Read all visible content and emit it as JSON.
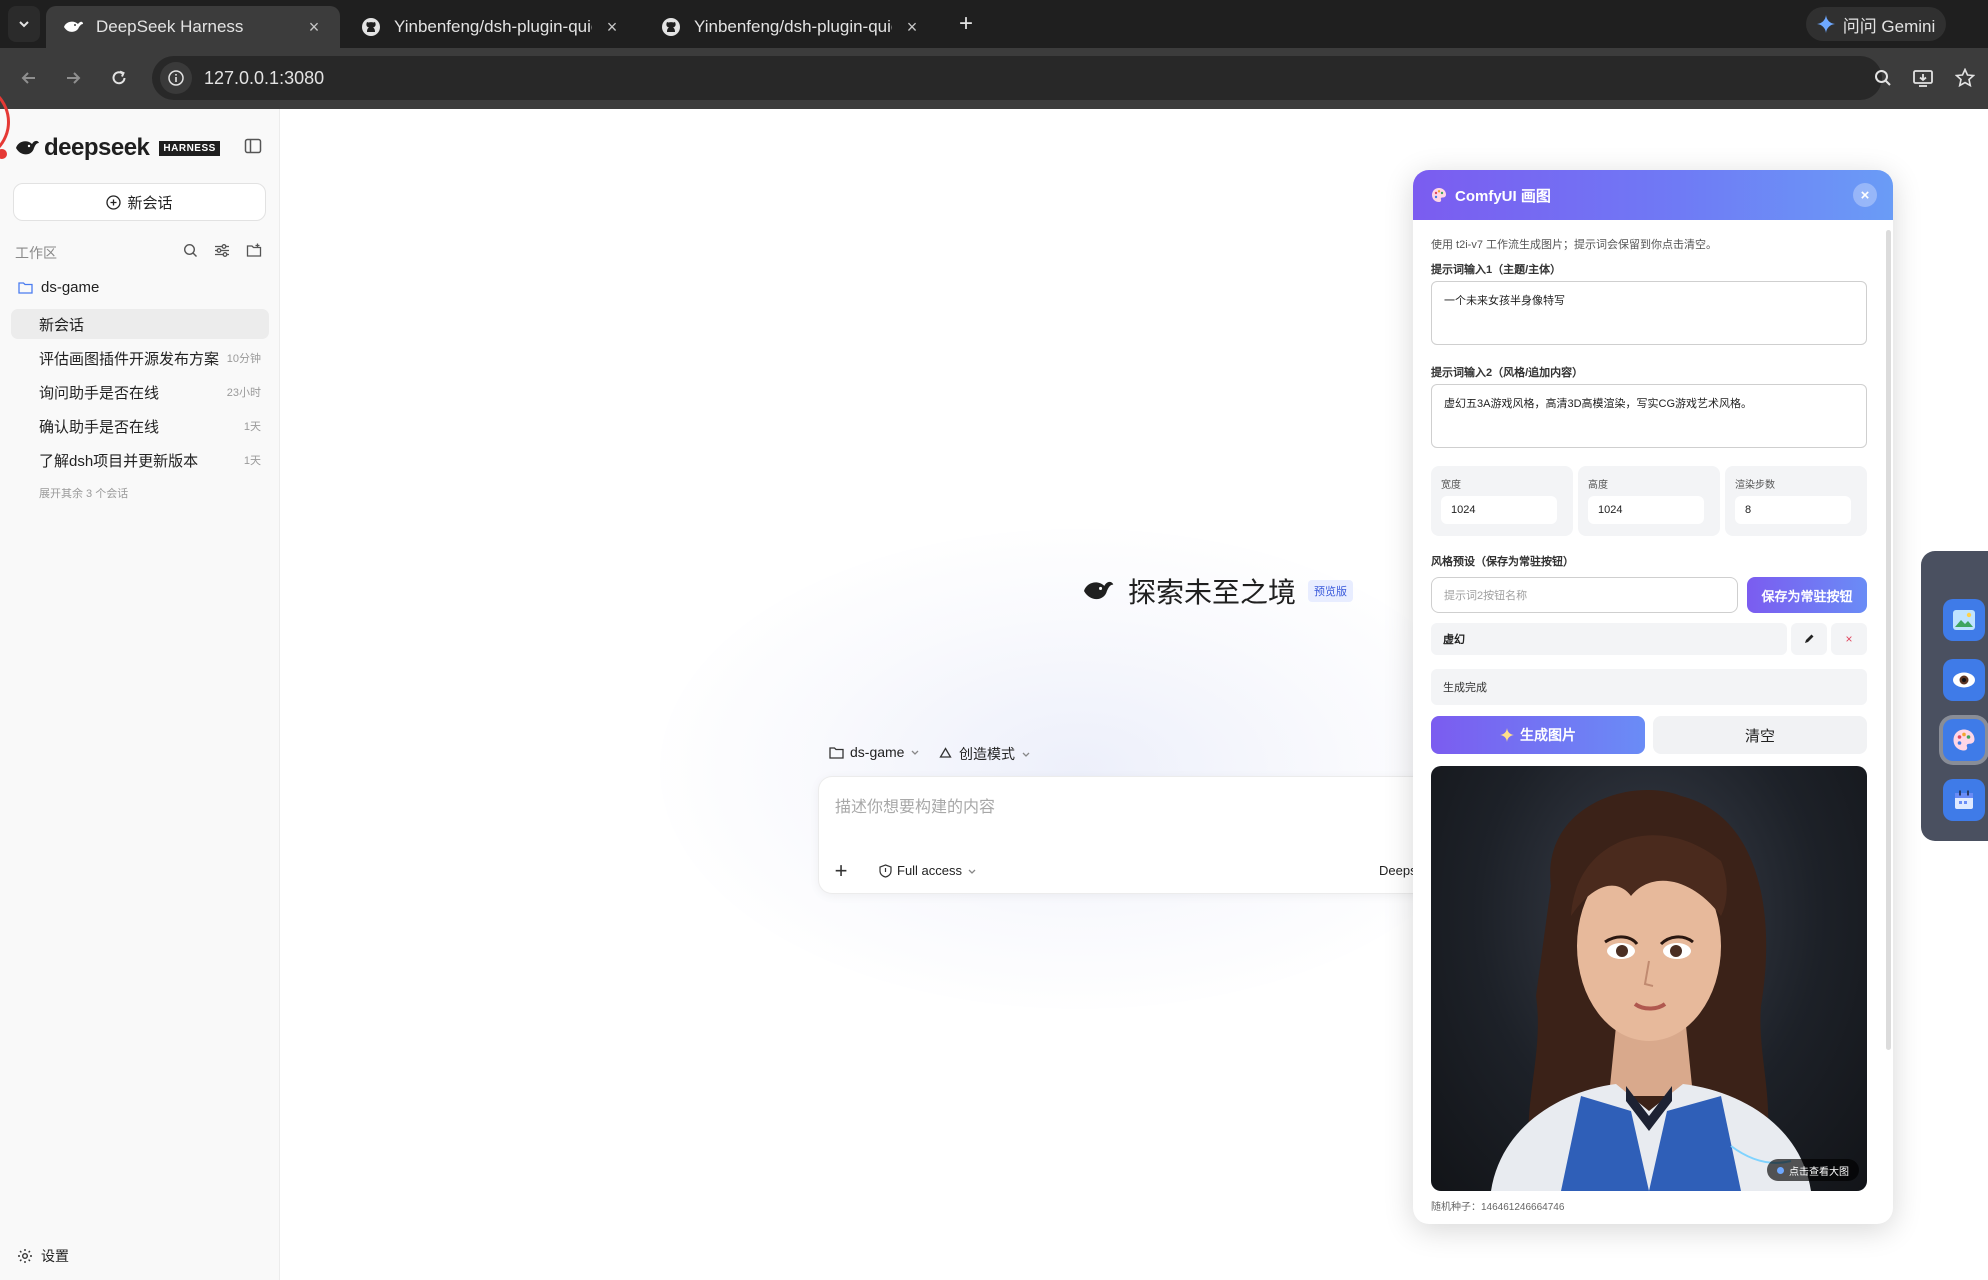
{
  "browser": {
    "tabs": [
      {
        "title": "DeepSeek Harness",
        "active": true
      },
      {
        "title": "Yinbenfeng/dsh-plugin-quick",
        "active": false
      },
      {
        "title": "Yinbenfeng/dsh-plugin-quick",
        "active": false
      }
    ],
    "gemini_label": "问问 Gemini",
    "url": "127.0.0.1:3080"
  },
  "sidebar": {
    "logo_text": "deepseek",
    "logo_badge": "HARNESS",
    "new_chat_label": "新会话",
    "workspace_label": "工作区",
    "folder_name": "ds-game",
    "conversations": [
      {
        "title": "新会话",
        "time": ""
      },
      {
        "title": "评估画图插件开源发布方案",
        "time": "10分钟"
      },
      {
        "title": "询问助手是否在线",
        "time": "23小时"
      },
      {
        "title": "确认助手是否在线",
        "time": "1天"
      },
      {
        "title": "了解dsh项目并更新版本",
        "time": "1天"
      }
    ],
    "expand_more": "展开其余 3 个会话",
    "settings_label": "设置"
  },
  "main": {
    "hero_title": "探索未至之境",
    "hero_badge": "预览版",
    "context_folder": "ds-game",
    "mode_label": "创造模式",
    "composer_placeholder": "描述你想要构建的内容",
    "access_label": "Full access",
    "model_label": "Deeps"
  },
  "comfy_panel": {
    "title": "ComfyUI 画图",
    "description": "使用 t2i-v7 工作流生成图片；提示词会保留到你点击清空。",
    "prompt1_label": "提示词输入1（主题/主体）",
    "prompt1_value": "一个未来女孩半身像特写",
    "prompt2_label": "提示词输入2（风格/追加内容）",
    "prompt2_value": "虚幻五3A游戏风格，高清3D高模渲染，写实CG游戏艺术风格。",
    "width_label": "宽度",
    "width_value": "1024",
    "height_label": "高度",
    "height_value": "1024",
    "steps_label": "渲染步数",
    "steps_value": "8",
    "preset_section_label": "风格预设（保存为常驻按钮）",
    "preset_name_placeholder": "提示词2按钮名称",
    "save_preset_label": "保存为常驻按钮",
    "preset_item": "虚幻",
    "status_text": "生成完成",
    "generate_label": "生成图片",
    "clear_label": "清空",
    "view_full_label": "点击查看大图",
    "seed_text": "随机种子：146461246664746"
  },
  "colors": {
    "accent_gradient_start": "#7b5cf0",
    "accent_gradient_end": "#6a9cf6",
    "dock_background": "#4a5060",
    "dock_item": "#3f7be8"
  },
  "dock": {
    "items": [
      "image-icon",
      "eye-icon",
      "palette-icon",
      "calendar-icon"
    ]
  }
}
